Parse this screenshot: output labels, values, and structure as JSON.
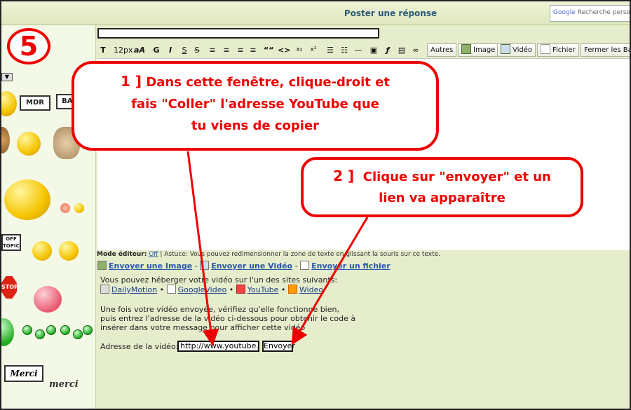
{
  "step_number": "5",
  "header": {
    "title": "Poster une réponse",
    "google_logo": "Google",
    "search_placeholder": "Recherche personnalisée"
  },
  "toolbar": {
    "font_size": "12px",
    "font_label": "aA",
    "bold": "G",
    "italic": "I",
    "underline": "S",
    "strike": "S",
    "quote": "““",
    "code": "<>",
    "sub": "x₂",
    "sup": "x²",
    "buttons": [
      "Autres",
      "Image",
      "Vidéo",
      "Fichier",
      "Fermer les Bali"
    ]
  },
  "callouts": {
    "one_number": "1 ]",
    "one_text_line1": "Dans cette fenêtre, clique-droit et",
    "one_text_line2": "fais \"Coller\" l'adresse YouTube que",
    "one_text_line3": "tu viens de copier",
    "two_number": "2 ]",
    "two_text_line1": "Clique sur \"envoyer\" et un",
    "two_text_line2": "lien va apparaître"
  },
  "help": {
    "mode_label": "Mode éditeur:",
    "mode_value": "Off",
    "tip": " | Astuce: Vous pouvez redimensionner la zone de texte en glissant la souris sur ce texte."
  },
  "upload_links": {
    "image": "Envoyer une Image",
    "video": "Envoyer une Vidéo",
    "file": "Envoyer un fichier",
    "sep": " - "
  },
  "video": {
    "intro": "Vous pouvez héberger votre vidéo sur l'un des sites suivants:",
    "sites": [
      "DailyMotion",
      "GoogleVideo",
      "YouTube",
      "Wideo"
    ],
    "info_line1": "Une fois votre vidéo envoyée, vérifiez qu'elle fonctionne bien,",
    "info_line2": "puis entrez l'adresse de la vidéo ci-dessous pour obtenir le code à",
    "info_line3": "insérer dans votre message pour afficher cette vidéo",
    "address_label": "Adresse de la vidéo:",
    "address_value": "http://www.youtube.com",
    "send_label": "Envoyer"
  },
  "smileys": {
    "sign_mdr": "MDR",
    "sign_ban": "BAN",
    "sign_offtopic": "OFF TOPIC!",
    "sign_stop": "STOP",
    "sign_merci": "Merci",
    "merci_text": "merci"
  },
  "colors": {
    "accent_red": "#e00000",
    "header_text": "#2d5a78",
    "link": "#2759a9",
    "background": "#e6edcc"
  }
}
